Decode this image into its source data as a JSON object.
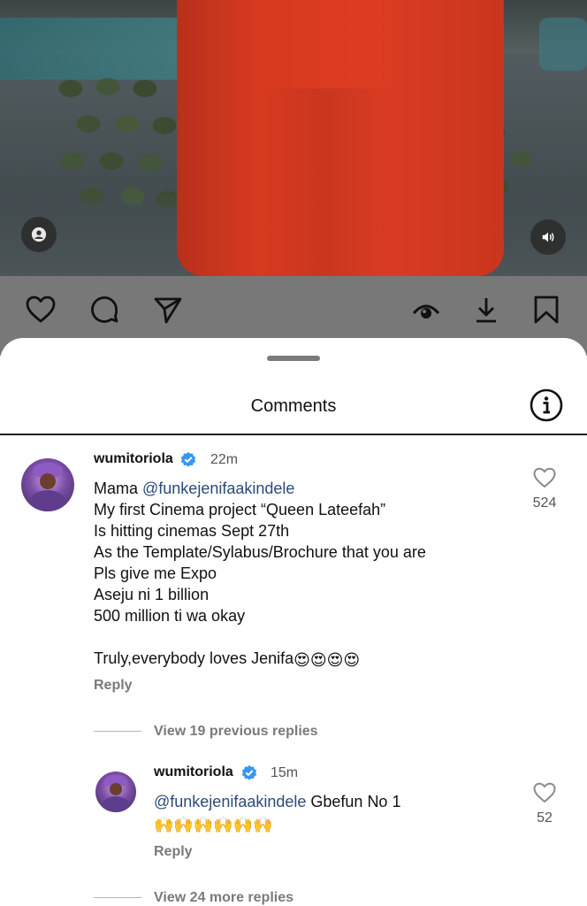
{
  "video": {
    "profile_icon": "person-icon",
    "sound_icon": "speaker-icon"
  },
  "actions": {
    "like_icon": "heart-outline-icon",
    "comment_icon": "comment-bubble-icon",
    "share_icon": "send-icon",
    "views_icon": "eye-icon",
    "download_icon": "download-icon",
    "save_icon": "bookmark-icon"
  },
  "sheet": {
    "title": "Comments",
    "info_icon": "info-icon"
  },
  "comment": {
    "username": "wumitoriola",
    "time": "22m",
    "mention": "@funkejenifaakindele",
    "prefix": "Mama ",
    "body": "My first Cinema project “Queen Lateefah”\nIs hitting cinemas Sept 27th\nAs the Template/Sylabus/Brochure that you are\nPls give me Expo\nAseju ni 1 billion\n500 million ti wa okay",
    "closing": "Truly,everybody loves Jenifa",
    "closing_emoji": "😍😍😍😍",
    "reply_label": "Reply",
    "likes": "524"
  },
  "previous_replies": "View 19 previous replies",
  "reply": {
    "username": "wumitoriola",
    "time": "15m",
    "mention": "@funkejenifaakindele",
    "text": " Gbefun No 1",
    "emoji": "🙌🙌🙌🙌🙌🙌",
    "reply_label": "Reply",
    "likes": "52"
  },
  "more_replies": "View 24 more replies",
  "colors": {
    "verified_blue": "#3797f0",
    "mention": "#2b4a7a",
    "muted": "#7a7a7a",
    "dim_overlay": "#787878"
  }
}
